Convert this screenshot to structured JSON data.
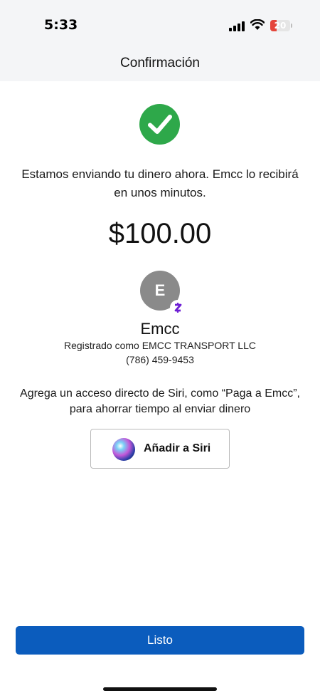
{
  "status_bar": {
    "time": "5:33",
    "battery_level": "20",
    "battery_color": "#e4453b",
    "icons": [
      "signal-icon",
      "wifi-icon",
      "battery-icon"
    ]
  },
  "header": {
    "title": "Confirmación"
  },
  "confirmation": {
    "success_icon": "check-circle-icon",
    "success_color": "#2ea84a",
    "message": "Estamos enviando tu dinero ahora. Emcc lo recibirá en unos minutos.",
    "amount": "$100.00"
  },
  "recipient": {
    "avatar_initial": "E",
    "badge": "Z",
    "badge_color": "#6d1ed4",
    "name": "Emcc",
    "registered_as": "Registrado como EMCC TRANSPORT LLC",
    "phone": "(786) 459-9453"
  },
  "siri": {
    "description": "Agrega un acceso directo de Siri, como “Paga a Emcc”, para ahorrar tiempo al enviar dinero",
    "button_label": "Añadir a Siri",
    "icon": "siri-icon"
  },
  "footer": {
    "done_label": "Listo",
    "accent_color": "#0b5cbd"
  }
}
